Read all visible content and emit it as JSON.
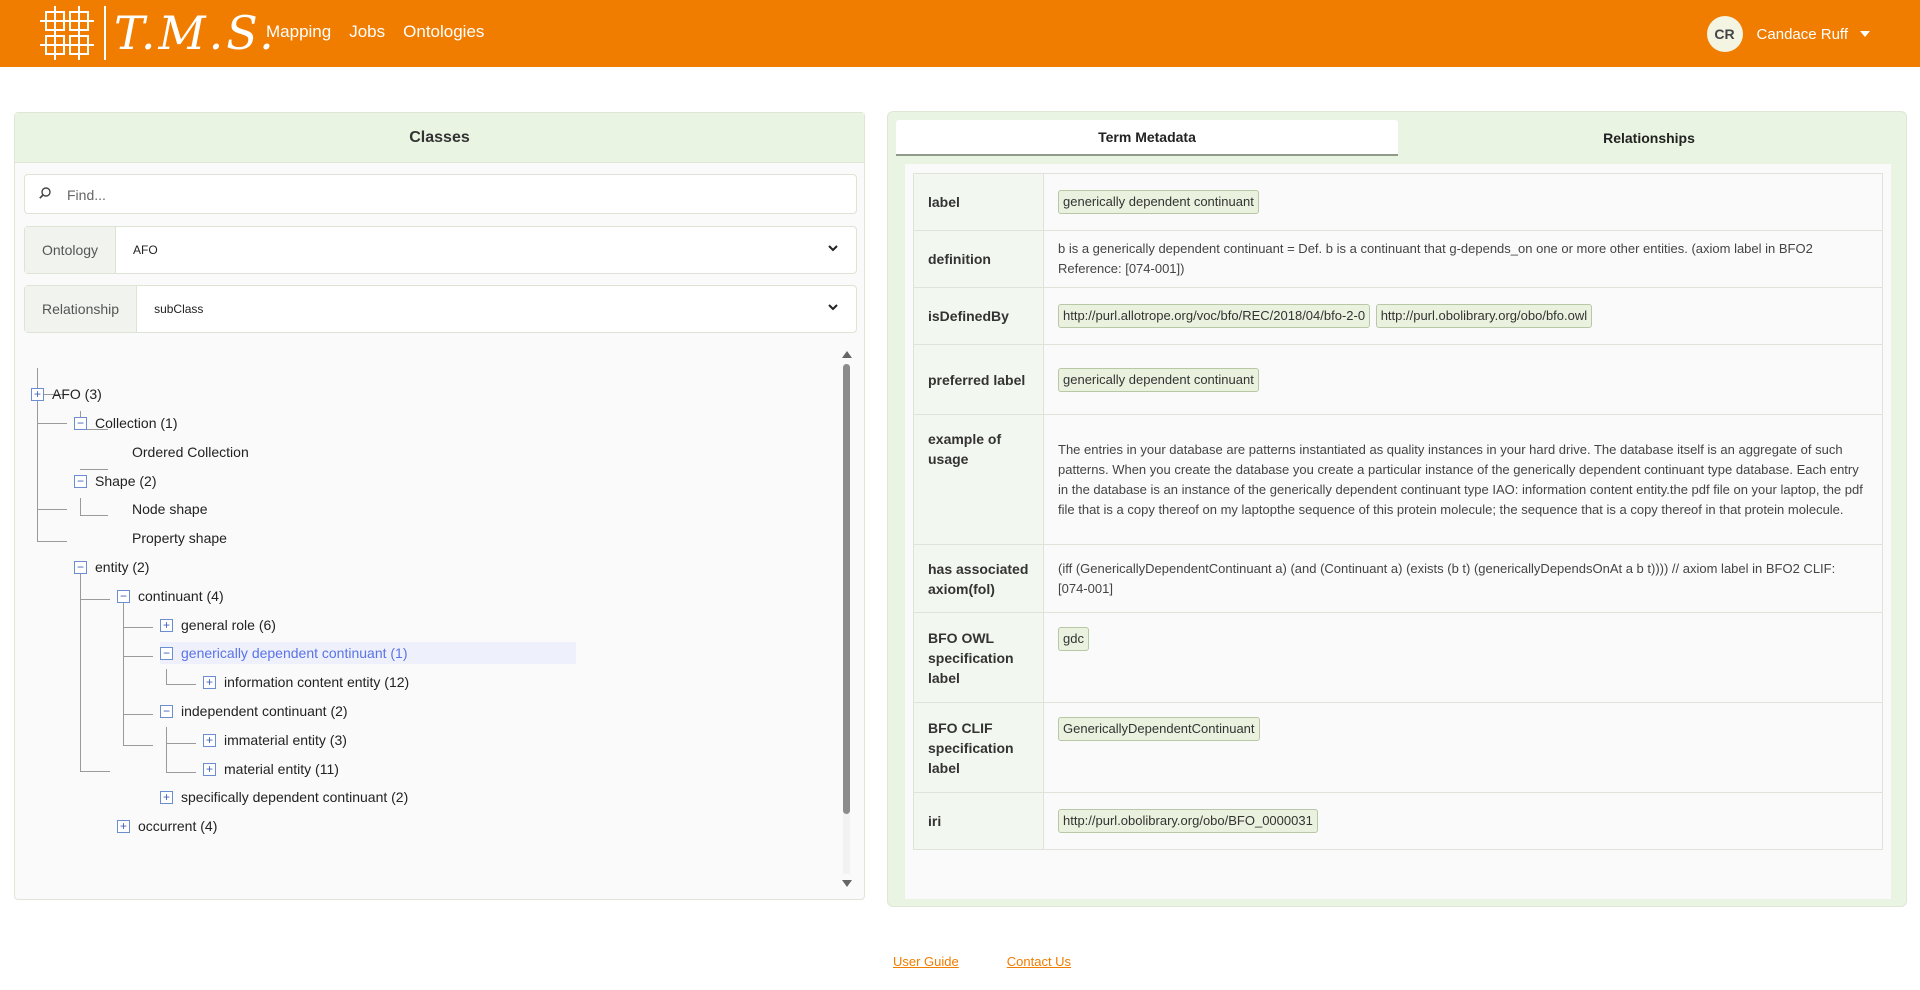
{
  "header": {
    "logo_text": "T.M.S.",
    "nav": [
      "Mapping",
      "Jobs",
      "Ontologies"
    ],
    "user_initials": "CR",
    "user_name": "Candace Ruff"
  },
  "classes_panel": {
    "title": "Classes",
    "search_placeholder": "Find...",
    "ontology_label": "Ontology",
    "ontology_value": "AFO",
    "relationship_label": "Relationship",
    "relationship_value": "subClass"
  },
  "tree": {
    "afo": "AFO (3)",
    "collection": "Collection (1)",
    "ordered_collection": "Ordered Collection",
    "shape": "Shape (2)",
    "node_shape": "Node shape",
    "property_shape": "Property shape",
    "entity": "entity (2)",
    "continuant": "continuant (4)",
    "general_role": "general role (6)",
    "gdc": "generically dependent continuant (1)",
    "ice": "information content entity (12)",
    "independent_continuant": "independent continuant (2)",
    "immaterial_entity": "immaterial entity (3)",
    "material_entity": "material entity (11)",
    "sdc": "specifically dependent continuant (2)",
    "occurrent": "occurrent (4)"
  },
  "tabs": {
    "term_metadata": "Term Metadata",
    "relationships": "Relationships"
  },
  "metadata": {
    "label_key": "label",
    "label_val": "generically dependent continuant",
    "definition_key": "definition",
    "definition_val": "b is a generically dependent continuant = Def. b is a continuant that g-depends_on one or more other entities. (axiom label in BFO2 Reference: [074-001])",
    "isdefinedby_key": "isDefinedBy",
    "isdefinedby_val1": "http://purl.allotrope.org/voc/bfo/REC/2018/04/bfo-2-0",
    "isdefinedby_val2": "http://purl.obolibrary.org/obo/bfo.owl",
    "preferred_key": "preferred label",
    "preferred_val": "generically dependent continuant",
    "example_key": "example of usage",
    "example_val": "The entries in your database are patterns instantiated as quality instances in your hard drive. The database itself is an aggregate of such patterns. When you create the database you create a particular instance of the generically dependent continuant type database. Each entry in the database is an instance of the generically dependent continuant type IAO: information content entity.the pdf file on your laptop, the pdf file that is a copy thereof on my laptopthe sequence of this protein molecule; the sequence that is a copy thereof in that protein molecule.",
    "axiom_key": "has associated axiom(fol)",
    "axiom_val": "(iff (GenericallyDependentContinuant a) (and (Continuant a) (exists (b t) (genericallyDependsOnAt a b t)))) // axiom label in BFO2 CLIF: [074-001]",
    "owl_key": "BFO OWL specification label",
    "owl_val": "gdc",
    "clif_key": "BFO CLIF specification label",
    "clif_val": "GenericallyDependentContinuant",
    "iri_key": "iri",
    "iri_val": "http://purl.obolibrary.org/obo/BFO_0000031"
  },
  "footer": {
    "user_guide": "User Guide",
    "contact_us": "Contact Us"
  },
  "colors": {
    "header": "#f07d00",
    "panel_green": "#eaf4e2",
    "selected_text": "#5b73e6"
  }
}
